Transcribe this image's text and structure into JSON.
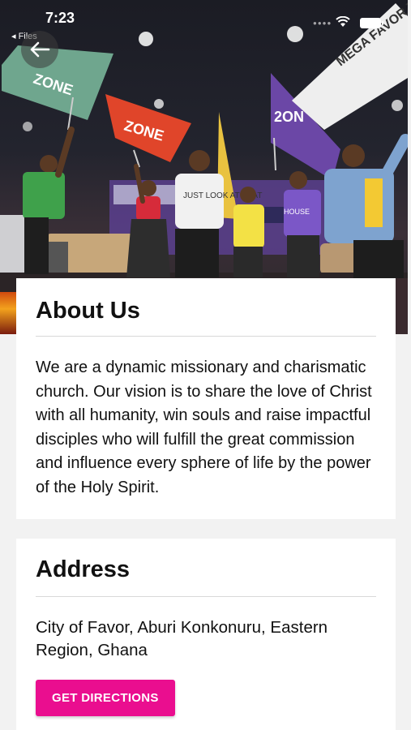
{
  "status_bar": {
    "time": "7:23",
    "back_app_label": "◂ Files"
  },
  "hero": {
    "flag_texts": [
      "ZONE",
      "ZONE",
      "2ON"
    ],
    "banner_text": "MEGA FAVOR TEMPLE",
    "shirt_text": "JUST LOOK AT THAT",
    "stage_text": "HOUSE"
  },
  "about": {
    "title": "About Us",
    "body": "We are a dynamic missionary and charismatic church. Our vision is to share the love of Christ with all humanity, win souls and raise impactful disciples who will fulfill the great commission and influence every sphere of life by the power of the Holy Spirit."
  },
  "address": {
    "title": "Address",
    "body": "City of Favor, Aburi Konkonuru, Eastern Region, Ghana",
    "button_label": "GET DIRECTIONS"
  },
  "colors": {
    "accent": "#ea0e8f",
    "card": "#ffffff",
    "background": "#f2f2f2"
  },
  "icons": {
    "back": "arrow-left-icon",
    "wifi": "wifi-icon",
    "battery": "battery-icon"
  }
}
